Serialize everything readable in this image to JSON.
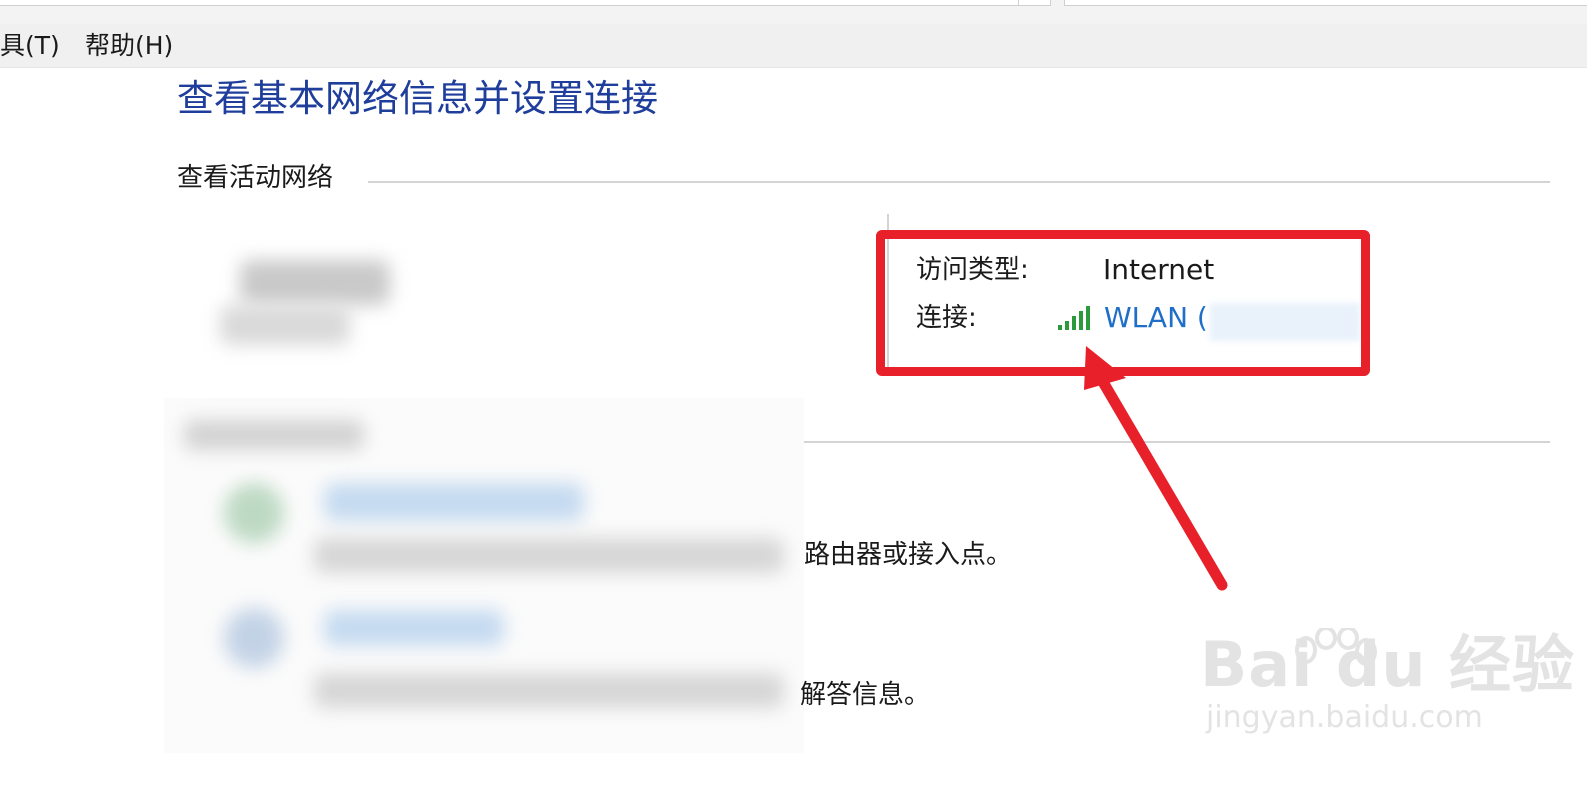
{
  "menu": {
    "tools": "具(T)",
    "help": "帮助(H)"
  },
  "main": {
    "title": "查看基本网络信息并设置连接",
    "active_networks_label": "查看活动网络",
    "access_type_label": "访问类型:",
    "access_type_value": "Internet",
    "connection_label": "连接:",
    "connection_value": "WLAN (",
    "signal_icon": "wifi-signal-bars-icon",
    "option1_text_tail": "路由器或接入点。",
    "option2_text_tail": "解答信息。"
  },
  "annotation": {
    "color": "#e8202a"
  },
  "watermark": {
    "main": "Bai du 经验",
    "sub": "jingyan.baidu.com"
  },
  "colors": {
    "title": "#1f3e9c",
    "link": "#1f6fc9",
    "signal": "#2a9a3c"
  }
}
